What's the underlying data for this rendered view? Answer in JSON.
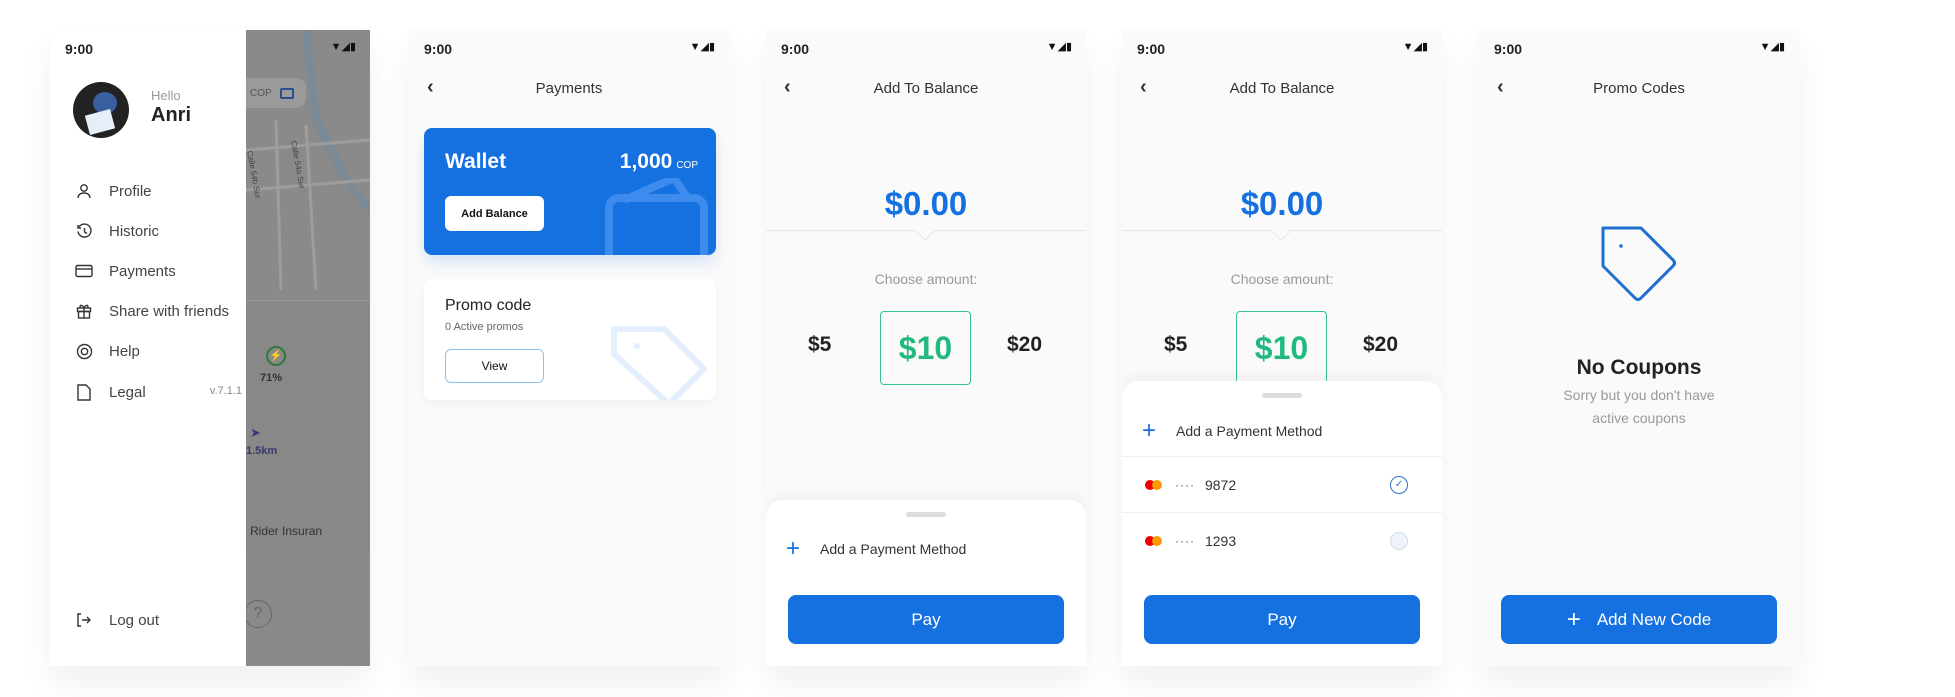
{
  "status_time": "9:00",
  "colors": {
    "primary": "#1570E0",
    "accent_green": "#22B97F"
  },
  "drawer": {
    "greeting": "Hello",
    "user_name": "Anri",
    "items": [
      {
        "label": "Profile",
        "icon": "user-icon"
      },
      {
        "label": "Historic",
        "icon": "history-icon"
      },
      {
        "label": "Payments",
        "icon": "credit-card-icon"
      },
      {
        "label": "Share with friends",
        "icon": "gift-icon"
      },
      {
        "label": "Help",
        "icon": "lifebuoy-icon"
      },
      {
        "label": "Legal",
        "icon": "document-icon"
      }
    ],
    "version": "v.7.1.1",
    "logout_label": "Log out",
    "map": {
      "currency": "COP",
      "battery": "71%",
      "distance": "1.5km",
      "insurance": "Rider Insuran",
      "street1": "Calle 54a Sur",
      "street2": "Calle 54b Sur",
      "help": "?"
    }
  },
  "payments": {
    "title": "Payments",
    "wallet": {
      "title": "Wallet",
      "balance": "1,000",
      "currency": "COP",
      "button": "Add Balance"
    },
    "promo": {
      "title": "Promo code",
      "subtitle": "0 Active promos",
      "button": "View"
    }
  },
  "add_balance": {
    "title": "Add To Balance",
    "amount": "$0.00",
    "choose_label": "Choose amount:",
    "options": [
      "$5",
      "$10",
      "$20"
    ],
    "selected": "$10",
    "add_method": "Add a Payment Method",
    "pay": "Pay",
    "cards": [
      {
        "mask": "····",
        "last4": "9872",
        "selected": true
      },
      {
        "mask": "····",
        "last4": "1293",
        "selected": false
      }
    ]
  },
  "promo_codes": {
    "title": "Promo Codes",
    "empty_title": "No Coupons",
    "empty_line1": "Sorry but you don't have",
    "empty_line2": "active coupons",
    "add_button": "Add New Code"
  }
}
